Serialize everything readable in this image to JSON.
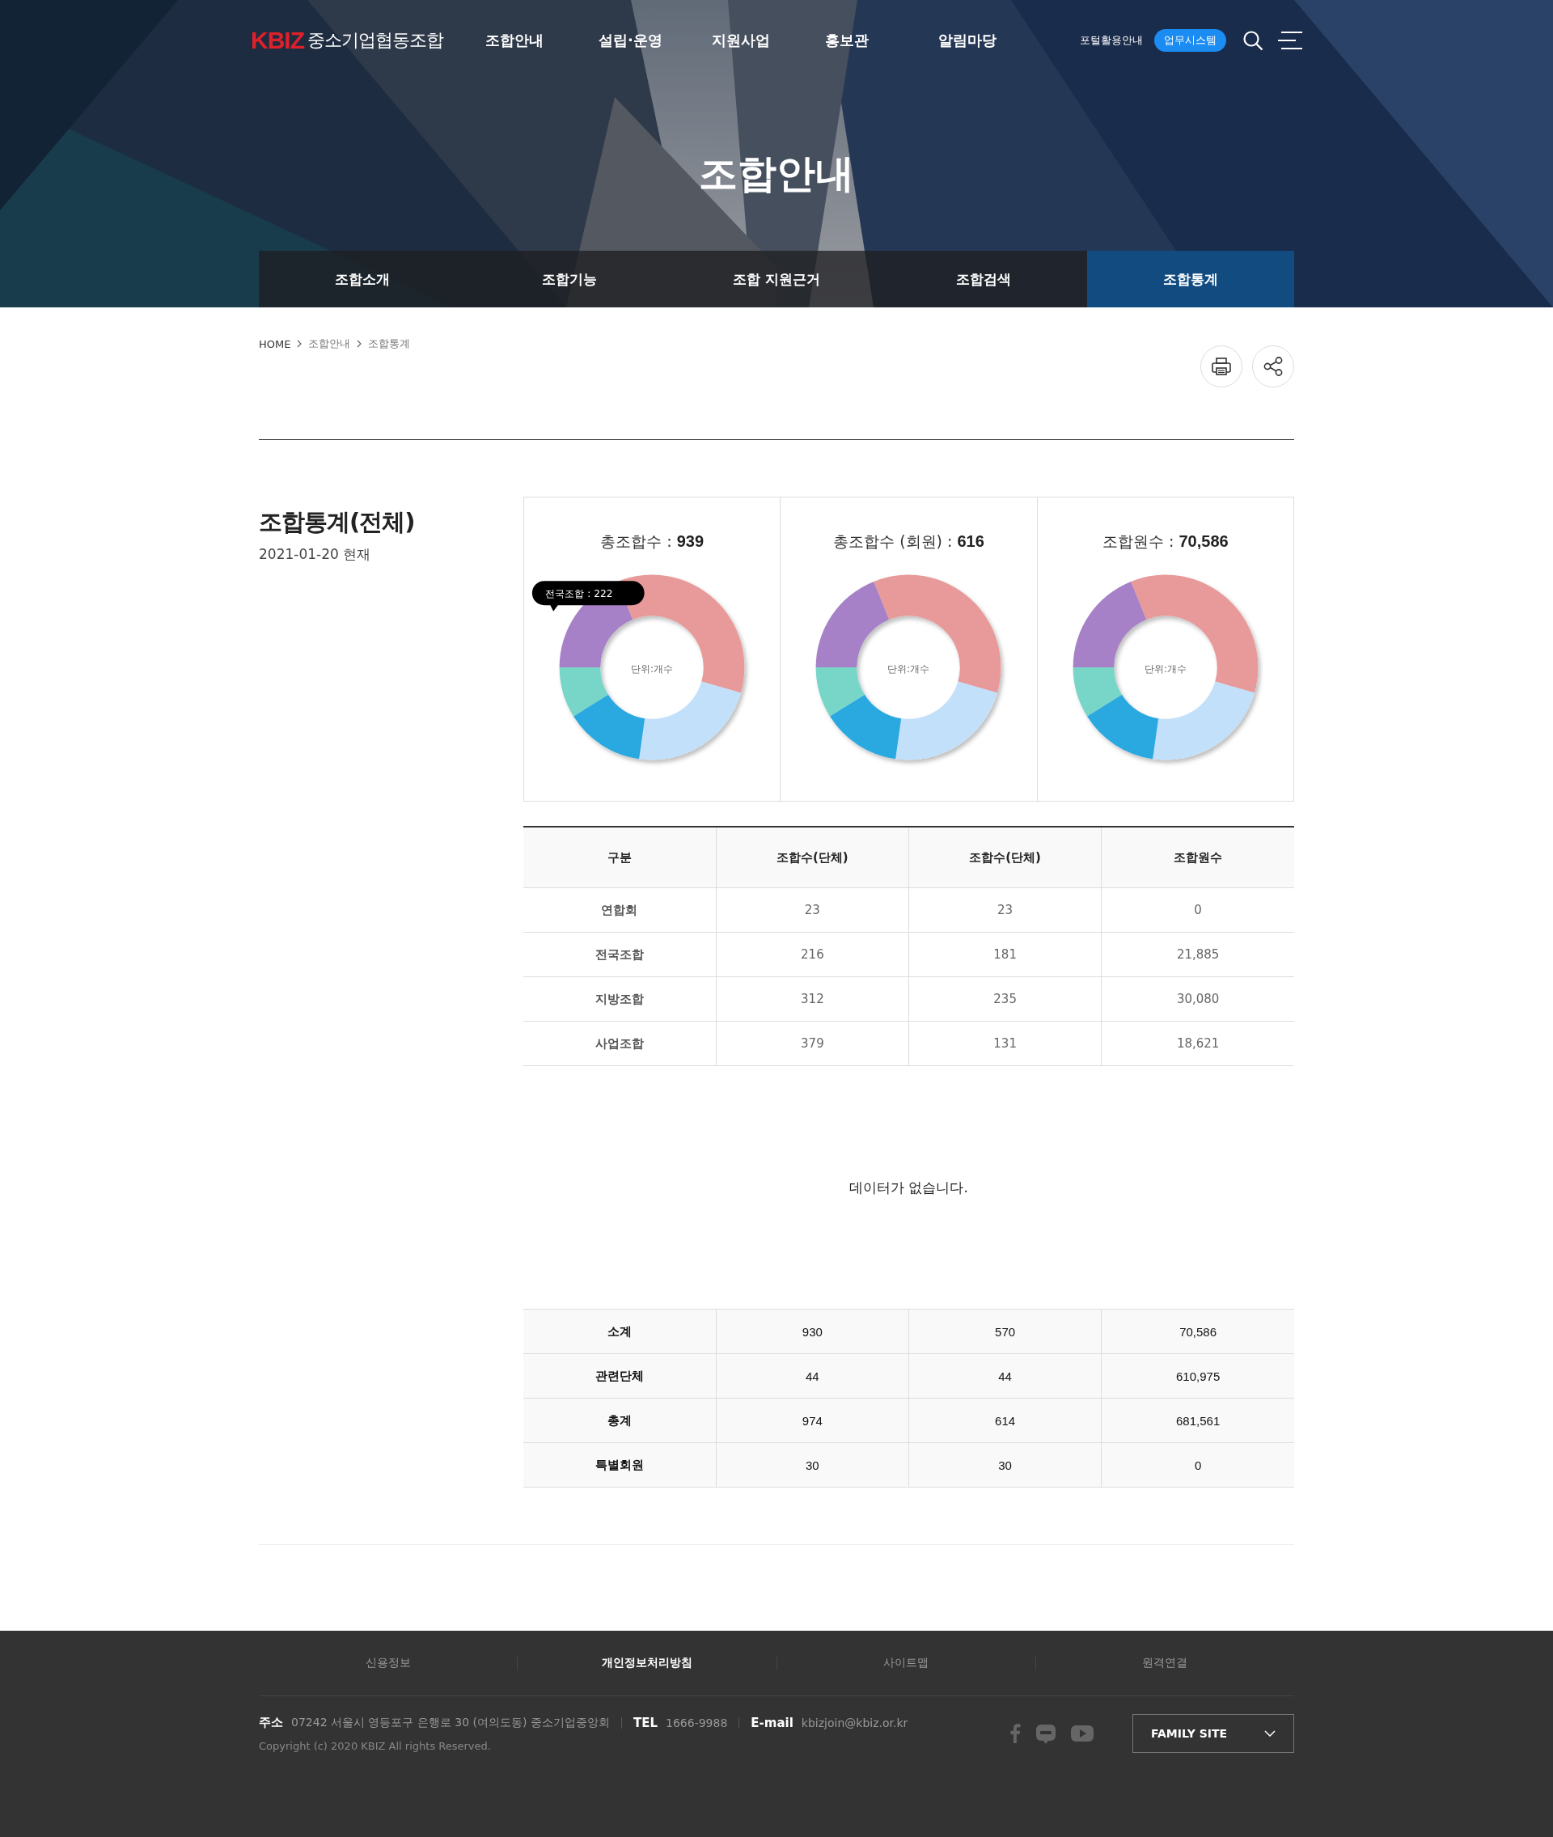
{
  "header": {
    "logo_mark": "KBIZ",
    "logo_text": "중소기업협동조합",
    "nav": [
      "조합안내",
      "설립·운영",
      "지원사업",
      "홍보관",
      "알림마당"
    ],
    "utility_link": "포털활용안내",
    "system_button": "업무시스템"
  },
  "hero": {
    "title": "조합안내"
  },
  "sub_tabs": [
    {
      "label": "조합소개",
      "selected": false
    },
    {
      "label": "조합기능",
      "selected": false
    },
    {
      "label": "조합 지원근거",
      "selected": false
    },
    {
      "label": "조합검색",
      "selected": false
    },
    {
      "label": "조합통계",
      "selected": true
    }
  ],
  "breadcrumb": [
    "HOME",
    "조합안내",
    "조합통계"
  ],
  "section": {
    "title": "조합통계(전체)",
    "date": "2021-01-20 현재"
  },
  "charts": [
    {
      "label": "총조합수 :",
      "value": "939",
      "center_label": "단위:개수",
      "tooltip": "전국조합 : 222"
    },
    {
      "label": "총조합수 (회원) :",
      "value": "616",
      "center_label": "단위:개수"
    },
    {
      "label": "조합원수 :",
      "value": "70,586",
      "center_label": "단위:개수"
    }
  ],
  "table": {
    "columns": [
      "구분",
      "조합수(단체)",
      "조합수(단체)",
      "조합원수"
    ],
    "rows": [
      [
        "연합회",
        "23",
        "23",
        "0"
      ],
      [
        "전국조합",
        "216",
        "181",
        "21,885"
      ],
      [
        "지방조합",
        "312",
        "235",
        "30,080"
      ],
      [
        "사업조합",
        "379",
        "131",
        "18,621"
      ]
    ]
  },
  "empty_message": "데이터가 없습니다.",
  "summary_rows": [
    [
      "소계",
      "930",
      "570",
      "70,586"
    ],
    [
      "관련단체",
      "44",
      "44",
      "610,975"
    ],
    [
      "총계",
      "974",
      "614",
      "681,561"
    ],
    [
      "특별회원",
      "30",
      "30",
      "0"
    ]
  ],
  "footer": {
    "links": [
      {
        "label": "신용정보",
        "emphasized": false
      },
      {
        "label": "개인정보처리방침",
        "emphasized": true
      },
      {
        "label": "사이트맵",
        "emphasized": false
      },
      {
        "label": "원격연결",
        "emphasized": false
      }
    ],
    "address_label": "주소",
    "address": "07242 서울시 영등포구 은행로 30 (여의도동) 중소기업중앙회",
    "tel_label": "TEL",
    "tel": "1666-9988",
    "email_label": "E-mail",
    "email": "kbizjoin@kbiz.or.kr",
    "copyright": "Copyright (c) 2020 KBIZ All rights Reserved.",
    "family_site": "FAMILY SITE"
  }
}
